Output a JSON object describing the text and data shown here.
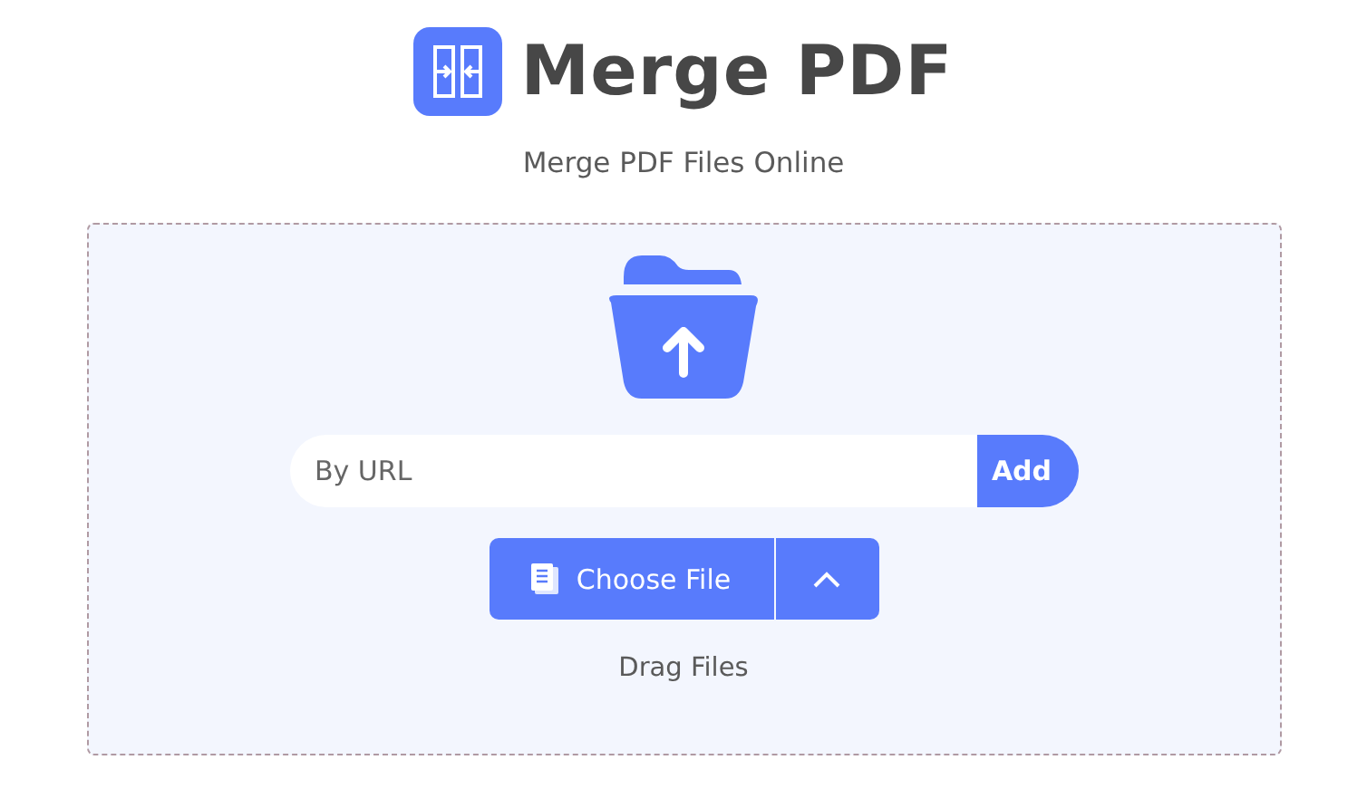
{
  "header": {
    "title": "Merge PDF",
    "subtitle": "Merge PDF Files Online"
  },
  "upload": {
    "url_field": {
      "placeholder": "By URL"
    },
    "add_button": "Add",
    "choose_button": "Choose File",
    "hint": "Drag Files"
  }
}
